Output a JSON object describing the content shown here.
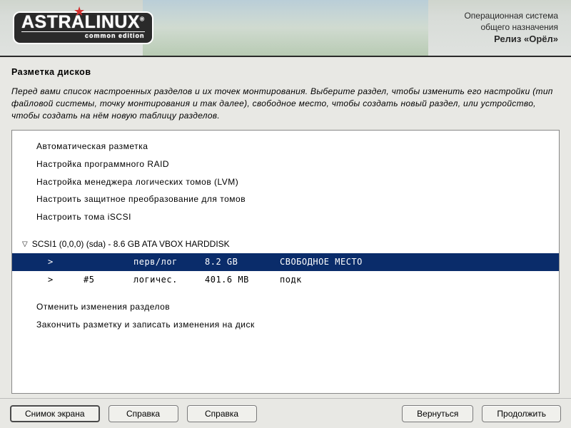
{
  "header": {
    "logo_main": "ASTRALINUX",
    "logo_sub": "common edition",
    "os_line1": "Операционная система",
    "os_line2": "общего назначения",
    "release": "Релиз «Орёл»"
  },
  "page": {
    "title": "Разметка дисков",
    "description": "Перед вами список настроенных разделов и их точек монтирования. Выберите раздел, чтобы изменить его настройки (тип файловой системы, точку монтирования и так далее), свободное место, чтобы создать новый раздел, или устройство, чтобы создать на нём новую таблицу разделов."
  },
  "menu": {
    "auto": "Автоматическая разметка",
    "raid": "Настройка программного RAID",
    "lvm": "Настройка менеджера логических томов (LVM)",
    "crypto": "Настроить защитное преобразование для томов",
    "iscsi": "Настроить тома iSCSI"
  },
  "disk": {
    "label": "SCSI1 (0,0,0) (sda) - 8.6 GB ATA VBOX HARDDISK",
    "rows": [
      {
        "marker": ">",
        "num": "",
        "type": "перв/лог",
        "size": "8.2 GB",
        "desc": "СВОБОДНОЕ МЕСТО",
        "selected": true
      },
      {
        "marker": ">",
        "num": "#5",
        "type": "логичес.",
        "size": "401.6 MB",
        "desc": "подк",
        "selected": false
      }
    ]
  },
  "actions": {
    "undo": "Отменить изменения разделов",
    "finish": "Закончить разметку и записать изменения на диск"
  },
  "footer": {
    "screenshot": "Снимок экрана",
    "help1": "Справка",
    "help2": "Справка",
    "back": "Вернуться",
    "continue": "Продолжить"
  }
}
